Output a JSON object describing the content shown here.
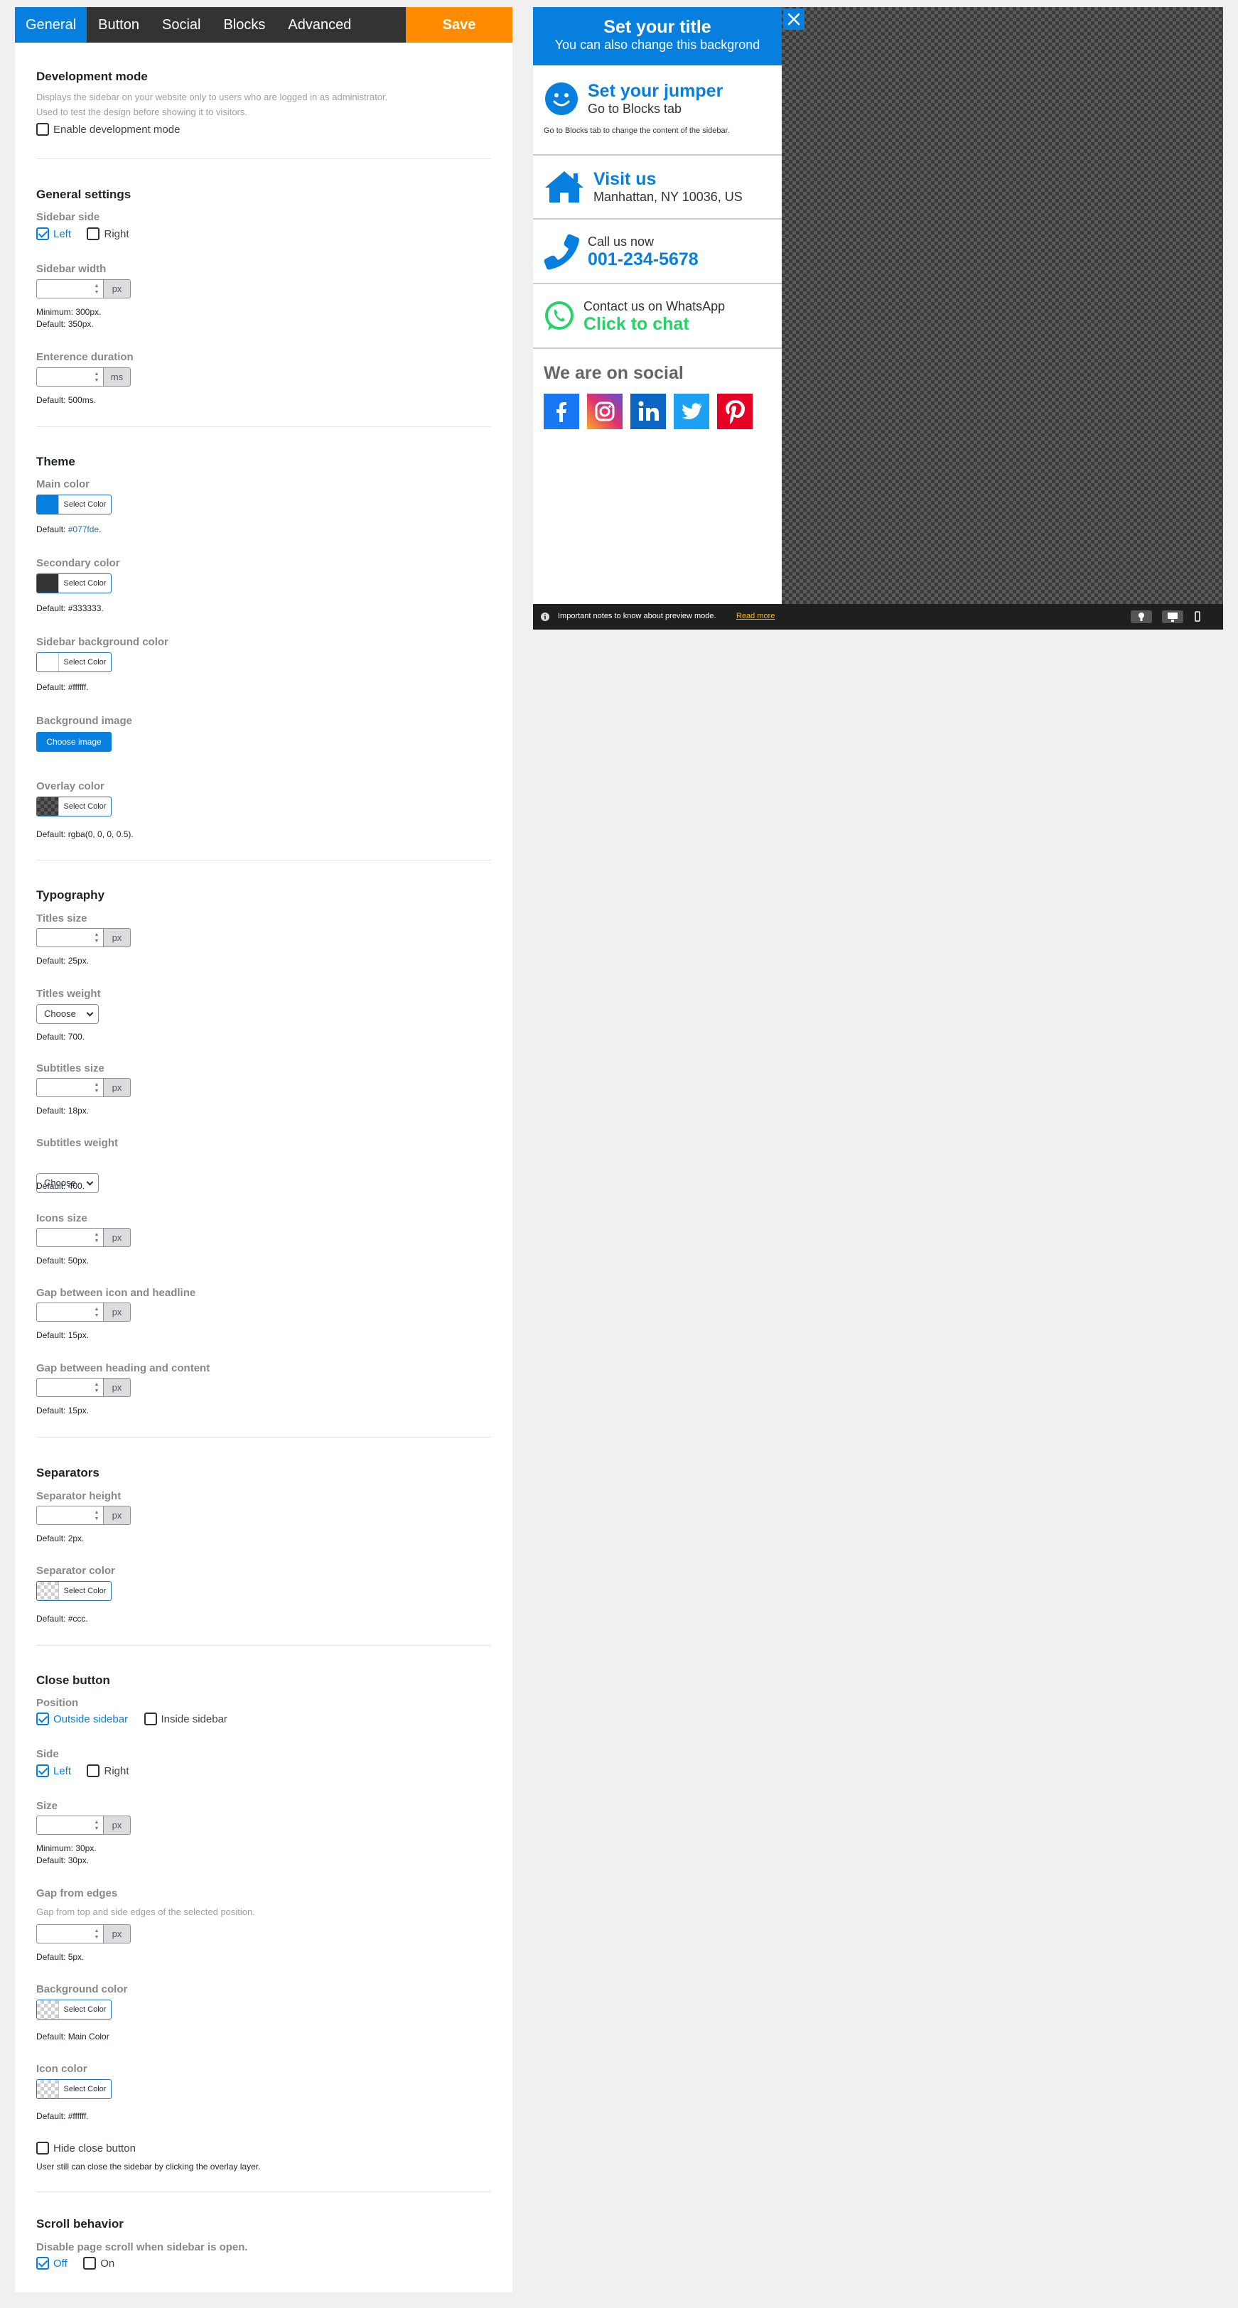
{
  "tabs": [
    {
      "label": "General",
      "active": true
    },
    {
      "label": "Button",
      "active": false
    },
    {
      "label": "Social",
      "active": false
    },
    {
      "label": "Blocks",
      "active": false
    },
    {
      "label": "Advanced",
      "active": false
    }
  ],
  "save_label": "Save",
  "dev_mode": {
    "title": "Development mode",
    "desc1": "Displays the sidebar on your website only to users who are logged in as administrator.",
    "desc2": "Used to test the design before showing it to visitors.",
    "checkbox_label": "Enable development mode"
  },
  "general": {
    "title": "General settings",
    "side_label": "Sidebar side",
    "side_left": "Left",
    "side_right": "Right",
    "width_label": "Sidebar width",
    "width_unit": "px",
    "width_min": "Minimum: 300px.",
    "width_default": "Default: 350px.",
    "duration_label": "Enterence duration",
    "duration_unit": "ms",
    "duration_default": "Default: 500ms."
  },
  "theme": {
    "title": "Theme",
    "main_label": "Main color",
    "main_default_prefix": "Default: ",
    "main_default_value": "#077fde",
    "main_default_suffix": ".",
    "secondary_label": "Secondary color",
    "secondary_default": "Default: #333333.",
    "bg_label": "Sidebar background color",
    "bg_default": "Default: #ffffff.",
    "image_label": "Background image",
    "image_button": "Choose image",
    "overlay_label": "Overlay color",
    "overlay_default": "Default: rgba(0, 0, 0, 0.5).",
    "select_color": "Select Color",
    "main_swatch": "#077fde",
    "secondary_swatch": "#333333"
  },
  "typography": {
    "title": "Typography",
    "titles_size_label": "Titles size",
    "titles_size_default": "Default: 25px.",
    "titles_weight_label": "Titles weight",
    "titles_weight_default": "Default: 700.",
    "subtitles_size_label": "Subtitles size",
    "subtitles_size_default": "Default: 18px.",
    "subtitles_weight_label": "Subtitles weight",
    "subtitles_weight_default": "Default: 400.",
    "icons_size_label": "Icons size",
    "icons_size_default": "Default: 50px.",
    "gap_icon_label": "Gap between icon and headline",
    "gap_icon_default": "Default: 15px.",
    "gap_heading_label": "Gap between heading and content",
    "gap_heading_default": "Default: 15px.",
    "unit": "px",
    "choose": "Choose"
  },
  "separators": {
    "title": "Separators",
    "height_label": "Separator height",
    "height_default": "Default: 2px.",
    "color_label": "Separator color",
    "color_default": "Default: #ccc.",
    "unit": "px",
    "select_color": "Select Color"
  },
  "close_button": {
    "title": "Close button",
    "position_label": "Position",
    "pos_outside": "Outside sidebar",
    "pos_inside": "Inside sidebar",
    "side_label": "Side",
    "side_left": "Left",
    "side_right": "Right",
    "size_label": "Size",
    "size_min": "Minimum: 30px.",
    "size_default": "Default: 30px.",
    "gap_label": "Gap from edges",
    "gap_desc": "Gap from top and side edges of the selected position.",
    "gap_default": "Default: 5px.",
    "bg_label": "Background color",
    "bg_default": "Default: Main Color",
    "icon_label": "Icon color",
    "icon_default": "Default: #ffffff.",
    "hide_label": "Hide close button",
    "hide_desc": "User still can close the sidebar by clicking the overlay layer.",
    "unit": "px",
    "select_color": "Select Color"
  },
  "scroll": {
    "title": "Scroll behavior",
    "desc": "Disable page scroll when sidebar is open.",
    "off": "Off",
    "on": "On"
  },
  "preview": {
    "title": "Set your title",
    "subtitle": "You can also change this backgrond",
    "jumper_head": "Set your jumper",
    "jumper_sub": "Go to Blocks tab",
    "jumper_content": "Go to Blocks tab to change the content of the sidebar.",
    "visit_head": "Visit us",
    "visit_sub": "Manhattan, NY 10036, US",
    "call_sub": "Call us now",
    "call_head": "001-234-5678",
    "wa_sub": "Contact us on WhatsApp",
    "wa_head": "Click to chat",
    "social_title": "We are on social",
    "note_text": "Important notes to know about preview mode.",
    "note_link": "Read more",
    "colors": {
      "facebook": "#1877f2",
      "linkedin": "#0a66c2",
      "twitter": "#1da1f2",
      "pinterest": "#e60023",
      "whatsapp": "#25d366"
    }
  }
}
